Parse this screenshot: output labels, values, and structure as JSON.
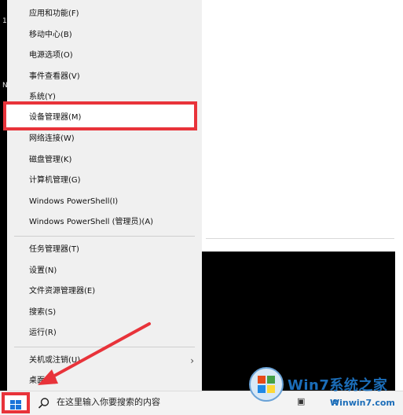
{
  "edge_glyphs": [
    "1",
    "N"
  ],
  "menu": {
    "items_top": [
      {
        "label": "应用和功能(F)"
      },
      {
        "label": "移动中心(B)"
      },
      {
        "label": "电源选项(O)"
      },
      {
        "label": "事件查看器(V)"
      },
      {
        "label": "系统(Y)"
      },
      {
        "label": "设备管理器(M)",
        "highlighted": true
      },
      {
        "label": "网络连接(W)"
      },
      {
        "label": "磁盘管理(K)"
      },
      {
        "label": "计算机管理(G)"
      },
      {
        "label": "Windows PowerShell(I)"
      },
      {
        "label": "Windows PowerShell (管理员)(A)"
      }
    ],
    "items_mid": [
      {
        "label": "任务管理器(T)"
      },
      {
        "label": "设置(N)"
      },
      {
        "label": "文件资源管理器(E)"
      },
      {
        "label": "搜索(S)"
      },
      {
        "label": "运行(R)"
      }
    ],
    "items_bottom": [
      {
        "label": "关机或注销(U)",
        "has_submenu": true
      },
      {
        "label": "桌面(D)"
      }
    ],
    "submenu_icon": "chevron-right-icon"
  },
  "taskbar": {
    "start_icon": "windows-logo-icon",
    "search_icon": "search-icon",
    "search_placeholder": "在这里输入你要搜索的内容"
  },
  "annotation": {
    "highlight_color": "#e8333a"
  },
  "watermark": {
    "text": "Win7系统之家",
    "url": "Winwin7.com"
  }
}
